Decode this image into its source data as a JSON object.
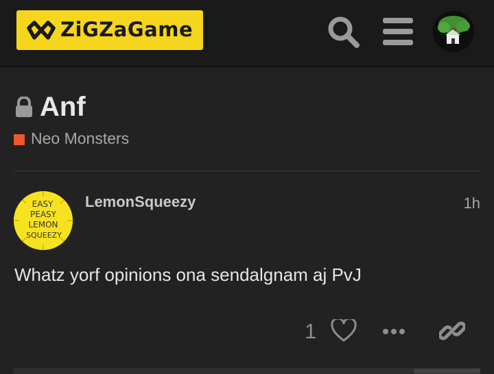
{
  "header": {
    "logo_text": "ZiGZaGame",
    "icons": [
      "search-icon",
      "hamburger-menu-icon",
      "user-avatar"
    ],
    "colors": {
      "background": "#1a1a1a",
      "logo_bg": "#f6d51d"
    }
  },
  "topic": {
    "title": "Anf",
    "locked": true,
    "category": {
      "name": "Neo Monsters",
      "color": "#f0572a"
    }
  },
  "post": {
    "username": "LemonSqueezy",
    "time": "1h",
    "avatar_text": [
      "EASY",
      "PEASY",
      "LEMON",
      "SQUEEZY"
    ],
    "body": "Whatz yorf opinions ona sendalgnam aj PvJ",
    "like_count": "1",
    "actions": [
      "heart-icon",
      "more-icon",
      "link-icon"
    ]
  }
}
